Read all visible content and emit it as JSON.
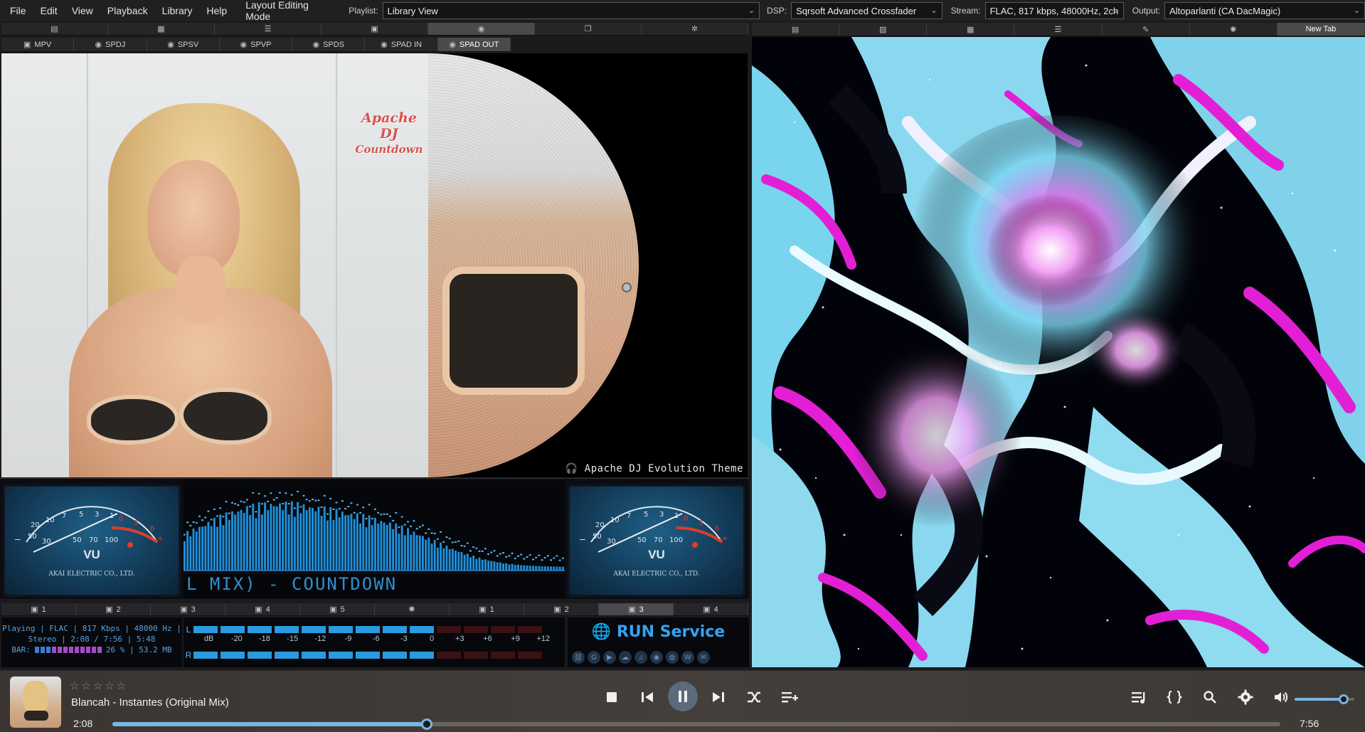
{
  "menu": {
    "items": [
      "File",
      "Edit",
      "View",
      "Playback",
      "Library",
      "Help",
      "Layout Editing Mode"
    ],
    "playlist_label": "Playlist:",
    "playlist_value": "Library View",
    "dsp_label": "DSP:",
    "dsp_value": "Sqrsoft Advanced Crossfader",
    "stream_label": "Stream:",
    "stream_value": "FLAC, 817 kbps, 48000Hz, 2ch",
    "output_label": "Output:",
    "output_value": "Altoparlanti (CA DacMagic)"
  },
  "left_icon_tabs": [
    {
      "icon": "document-icon",
      "glyph": "▤"
    },
    {
      "icon": "grid-icon",
      "glyph": "▦"
    },
    {
      "icon": "list-icon",
      "glyph": "☰"
    },
    {
      "icon": "window-icon",
      "glyph": "▣"
    },
    {
      "icon": "disc-icon",
      "glyph": "◉",
      "active": true
    },
    {
      "icon": "copy-icon",
      "glyph": "❐"
    },
    {
      "icon": "gear-icon",
      "glyph": "✲"
    }
  ],
  "left_sub_tabs": [
    {
      "label": "MPV",
      "glyph": "▣"
    },
    {
      "label": "SPDJ",
      "glyph": "◉"
    },
    {
      "label": "SPSV",
      "glyph": "◉"
    },
    {
      "label": "SPVP",
      "glyph": "◉"
    },
    {
      "label": "SPDS",
      "glyph": "◉"
    },
    {
      "label": "SPAD IN",
      "glyph": "◉"
    },
    {
      "label": "SPAD OUT",
      "glyph": "◉",
      "active": true
    }
  ],
  "right_tabs": [
    {
      "icon": "document-icon",
      "glyph": "▤",
      "label": ""
    },
    {
      "icon": "image-icon",
      "glyph": "▨",
      "label": ""
    },
    {
      "icon": "grid-icon",
      "glyph": "▦",
      "label": ""
    },
    {
      "icon": "list-icon",
      "glyph": "☰",
      "label": ""
    },
    {
      "icon": "brush-icon",
      "glyph": "✎",
      "label": ""
    },
    {
      "icon": "visual-icon",
      "glyph": "✺",
      "label": ""
    },
    {
      "icon": "",
      "glyph": "",
      "label": "New Tab",
      "active": true
    }
  ],
  "cover_panel": {
    "logo_line1": "Apache DJ",
    "logo_line2": "Countdown",
    "theme_label": "🎧 Apache DJ Evolution Theme"
  },
  "vu_left": {
    "scale": [
      "20",
      "10",
      "7",
      "5",
      "3",
      "1",
      "0",
      "1",
      "2",
      "3",
      "-",
      "+"
    ],
    "label": "VU",
    "maker": "AKAI ELECTRIC CO., LTD."
  },
  "vu_right": {
    "label": "VU",
    "maker": "AKAI ELECTRIC CO., LTD."
  },
  "ticker_text": "L MIX) - COUNTDOWN",
  "lower_tabs": [
    {
      "glyph": "▣",
      "label": "1"
    },
    {
      "glyph": "▣",
      "label": "2"
    },
    {
      "glyph": "▣",
      "label": "3"
    },
    {
      "glyph": "▣",
      "label": "4"
    },
    {
      "glyph": "▣",
      "label": "5"
    },
    {
      "glyph": "✺",
      "label": ""
    },
    {
      "glyph": "▣",
      "label": "1"
    },
    {
      "glyph": "▣",
      "label": "2"
    },
    {
      "glyph": "▣",
      "label": "3",
      "active": true
    },
    {
      "glyph": "▣",
      "label": "4"
    }
  ],
  "info": {
    "line1": "Playing | FLAC | 817 Kbps | 48000 Hz |",
    "line2": "Stereo | 2:08 / 7:56 | 5:48",
    "bar_label": "BAR:",
    "bar_value": "26 % | 53.2 MB",
    "bar_fraction": 0.26
  },
  "levels": {
    "left_label": "L",
    "right_label": "R",
    "scale": [
      "dB",
      "-20",
      "-18",
      "-15",
      "-12",
      "-9",
      "-6",
      "-3",
      "0",
      "+3",
      "+6",
      "+9",
      "+12"
    ],
    "left_level_fraction": 0.69,
    "right_level_fraction": 0.69
  },
  "run_service": {
    "label": "RUN Service",
    "icons": [
      "link-icon",
      "google-icon",
      "video-icon",
      "cloud-icon",
      "spotify-icon",
      "disc-icon",
      "globe-icon",
      "wiki-icon",
      "chat-icon"
    ]
  },
  "player": {
    "rating": "☆☆☆☆☆",
    "track": "Blancah - Instantes (Original Mix)",
    "time_current": "2:08",
    "time_total": "7:56",
    "progress_fraction": 0.269,
    "volume_fraction": 0.82
  },
  "colors": {
    "accent": "#7ab3e4",
    "meter_blue": "#2a9be0",
    "viz_cyan": "#6fd6f2",
    "viz_magenta": "#e31fd6"
  }
}
